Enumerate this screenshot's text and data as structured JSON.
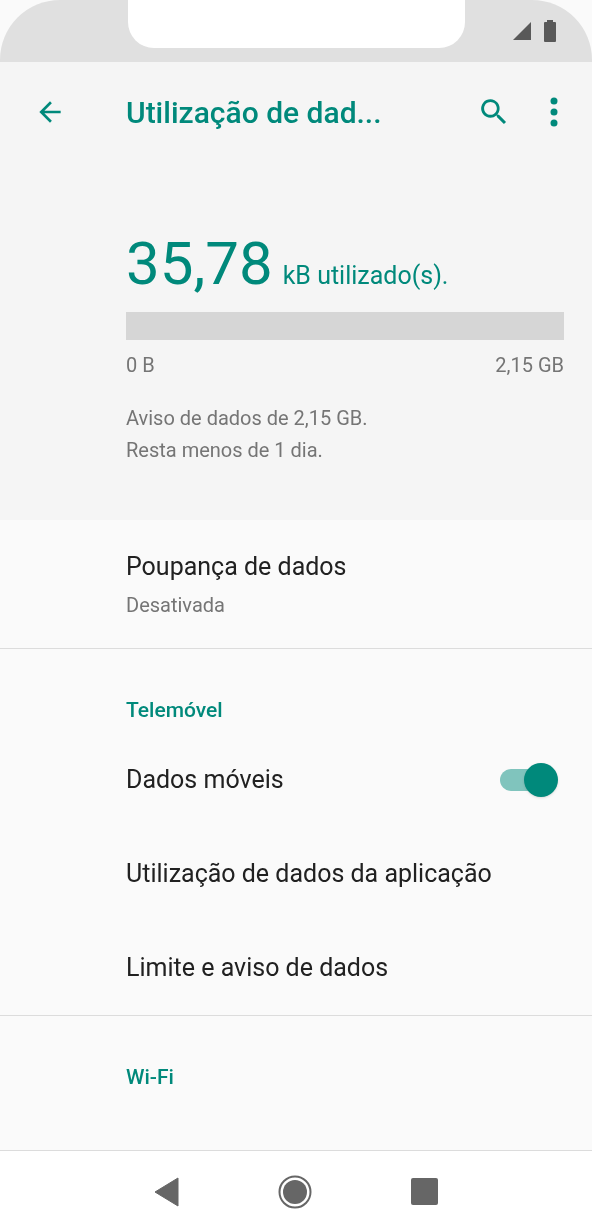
{
  "toolbar": {
    "title": "Utilização de dad..."
  },
  "usage": {
    "amount": "35,78",
    "unit": "kB utilizado(s).",
    "level": 0,
    "min_label": "0 B",
    "max_label": "2,15 GB",
    "notes": [
      "Aviso de dados de 2,15 GB.",
      "Resta menos de 1 dia."
    ]
  },
  "sections": [
    {
      "items": [
        {
          "kind": "text",
          "title": "Poupança de dados",
          "subtitle": "Desativada"
        }
      ]
    },
    {
      "header": "Telemóvel",
      "items": [
        {
          "kind": "switch",
          "title": "Dados móveis",
          "on": true
        },
        {
          "kind": "text",
          "title": "Utilização de dados da aplicação"
        },
        {
          "kind": "text",
          "title": "Limite e aviso de dados"
        }
      ]
    },
    {
      "header": "Wi-Fi"
    }
  ]
}
